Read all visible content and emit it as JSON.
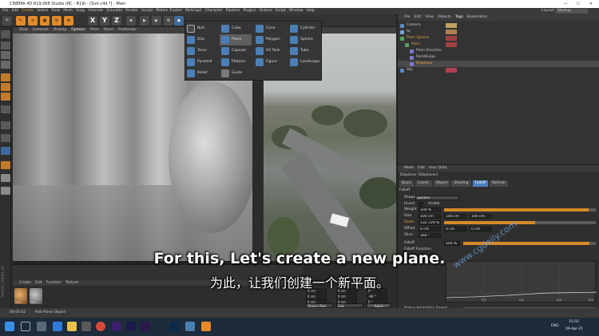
{
  "titlebar": {
    "title": "CINEMA 4D R19.068 Studio (RC - R19) - [Svit.c4d *] - Main",
    "min": "—",
    "max": "☐",
    "close": "✕"
  },
  "menubar": [
    "File",
    "Edit",
    "Create",
    "Select",
    "Tools",
    "Mesh",
    "Snap",
    "Animate",
    "Simulate",
    "Render",
    "Sculpt",
    "Motion Tracker",
    "MoGraph",
    "Character",
    "Pipeline",
    "Plugins",
    "Octane",
    "Script",
    "Window",
    "Help"
  ],
  "toolbar": {
    "xyz": [
      "X",
      "Y",
      "Z"
    ]
  },
  "viewport": {
    "menu": [
      "View",
      "Cameras",
      "Display",
      "Options",
      "Filter",
      "Panel",
      "ProRender"
    ],
    "active_menu": "Options"
  },
  "create_popup": {
    "items": [
      [
        "Null",
        "Cube",
        "Cone",
        "Cylinder"
      ],
      [
        "Disc",
        "Plane",
        "Polygon",
        "Sphere"
      ],
      [
        "Torus",
        "Capsule",
        "Oil Tank",
        "Tube"
      ],
      [
        "Pyramid",
        "Platonic",
        "Figure",
        "Landscape"
      ],
      [
        "Relief",
        "Guide",
        "",
        ""
      ]
    ],
    "selected": "Plane"
  },
  "object_manager": {
    "menu": [
      "File",
      "Edit",
      "View",
      "Objects",
      "Tags",
      "Bookmarks"
    ],
    "layout_label": "Layout:",
    "layout_value": "Startup",
    "objects": [
      {
        "name": "Camera",
        "indent": 0
      },
      {
        "name": "Ac",
        "indent": 0
      },
      {
        "name": "Plain Sphere",
        "indent": 0
      },
      {
        "name": "Plain",
        "indent": 1
      },
      {
        "name": "Plain Shockfor",
        "indent": 2
      },
      {
        "name": "PointBulge",
        "indent": 2
      },
      {
        "name": "Displacer",
        "indent": 2
      },
      {
        "name": "Sky",
        "indent": 0
      }
    ]
  },
  "attribute_manager": {
    "menu": [
      "Mode",
      "Edit",
      "User Data"
    ],
    "title": "Displacer [Displacer]",
    "tabs": [
      "Basic",
      "Coord.",
      "Object",
      "Shading",
      "Falloff",
      "Refresh"
    ],
    "active_tab": "Falloff",
    "section": "Falloff",
    "params": [
      {
        "label": "Shape",
        "value": "Sphere"
      },
      {
        "label": "Invert",
        "value": "Visible"
      },
      {
        "label": "Weight",
        "value": "100 %"
      },
      {
        "label": "Size",
        "value": "100 cm",
        "v2": "100 cm",
        "v3": "100 cm"
      },
      {
        "label": "Scale",
        "value": "132.729 %"
      },
      {
        "label": "Offset",
        "value": "0 cm",
        "v2": "0 cm",
        "v3": "0 cm"
      },
      {
        "label": "Slice",
        "value": "360 °"
      },
      {
        "label": "Falloff",
        "value": "100 %"
      },
      {
        "label": "Falloff Function",
        "value": ""
      },
      {
        "label": "Spline Animation Speed",
        "value": ""
      }
    ],
    "weight_fill": 0.95,
    "scale_fill": 0.6,
    "falloff_fill": 0.95,
    "graph_ticks": [
      "0.2",
      "0.4",
      "0.6",
      "0.8"
    ]
  },
  "material_manager": {
    "menu": [
      "Create",
      "Edit",
      "Function",
      "Texture"
    ],
    "materials": [
      "Mat",
      "Mat"
    ]
  },
  "coord_manager": {
    "rows": [
      [
        "0 cm",
        "0 cm",
        "0 °"
      ],
      [
        "0 cm",
        "0 cm",
        "-90 °"
      ],
      [
        "0 cm",
        "0 cm",
        "0 °"
      ]
    ],
    "mode": "Object (Rel)",
    "size_mode": "Size",
    "apply": "Apply"
  },
  "side_label": "MAXON CINEMA 4D",
  "statusbar": {
    "time": "00:00:02",
    "message": "Add Plane Object"
  },
  "taskbar": {
    "lang": "ENG",
    "time": "15:02",
    "date": "09-Apr-21"
  },
  "subtitles": {
    "en": "For this, Let's create a new plane.",
    "zh": "为此，让我们创建一个新平面。"
  },
  "watermark": "www.cgdaily.com"
}
